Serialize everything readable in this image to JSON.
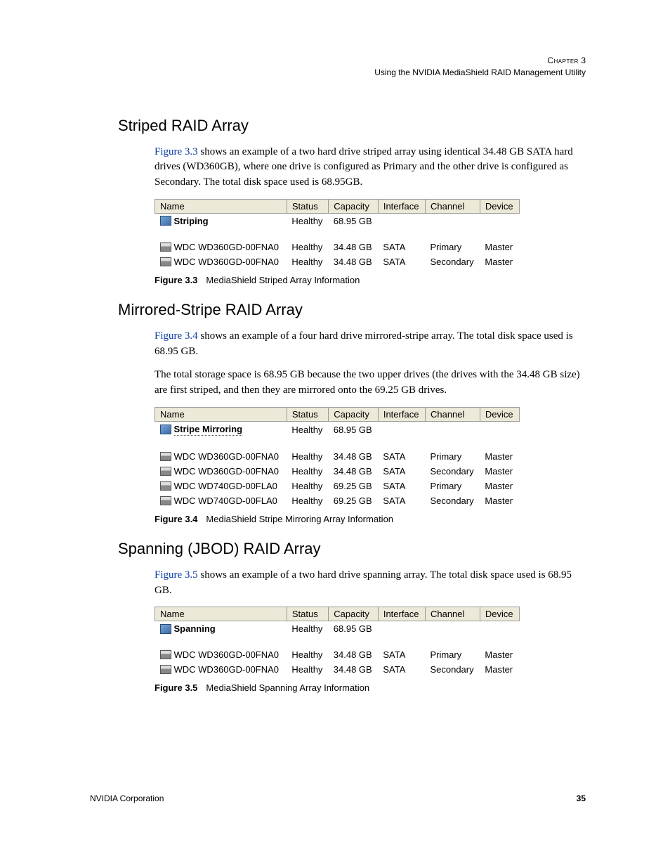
{
  "header": {
    "chapter_label": "Chapter",
    "chapter_number": "3",
    "subtitle": "Using the NVIDIA MediaShield RAID Management Utility"
  },
  "sections": {
    "striped": {
      "title": "Striped RAID Array",
      "ref": "Figure 3.3",
      "para1_rest": " shows an example of a two hard drive striped array using identical 34.48 GB SATA hard drives (WD360GB), where one drive is configured as Primary and the other drive is configured as Secondary. The total disk space used is 68.95GB.",
      "caption_num": "Figure 3.3",
      "caption_text": "MediaShield Striped Array Information",
      "table": {
        "headers": [
          "Name",
          "Status",
          "Capacity",
          "Interface",
          "Channel",
          "Device"
        ],
        "top_row": {
          "name": "Striping",
          "status": "Healthy",
          "capacity": "68.95 GB"
        },
        "rows": [
          {
            "name": "WDC WD360GD-00FNA0",
            "status": "Healthy",
            "capacity": "34.48 GB",
            "interface": "SATA",
            "channel": "Primary",
            "device": "Master"
          },
          {
            "name": "WDC WD360GD-00FNA0",
            "status": "Healthy",
            "capacity": "34.48 GB",
            "interface": "SATA",
            "channel": "Secondary",
            "device": "Master"
          }
        ]
      }
    },
    "mirrored": {
      "title": "Mirrored-Stripe RAID Array",
      "ref": "Figure 3.4",
      "para1_rest": " shows an example of a four hard drive mirrored-stripe array. The total disk space used is 68.95 GB.",
      "para2": "The total storage space is 68.95 GB because the two upper drives (the drives with the 34.48 GB size) are first striped, and then they are mirrored onto the 69.25 GB drives.",
      "caption_num": "Figure 3.4",
      "caption_text": "MediaShield Stripe Mirroring Array Information",
      "table": {
        "headers": [
          "Name",
          "Status",
          "Capacity",
          "Interface",
          "Channel",
          "Device"
        ],
        "top_row": {
          "name": "Stripe Mirroring",
          "status": "Healthy",
          "capacity": "68.95 GB"
        },
        "rows": [
          {
            "name": "WDC WD360GD-00FNA0",
            "status": "Healthy",
            "capacity": "34.48 GB",
            "interface": "SATA",
            "channel": "Primary",
            "device": "Master"
          },
          {
            "name": "WDC WD360GD-00FNA0",
            "status": "Healthy",
            "capacity": "34.48 GB",
            "interface": "SATA",
            "channel": "Secondary",
            "device": "Master"
          },
          {
            "name": "WDC WD740GD-00FLA0",
            "status": "Healthy",
            "capacity": "69.25 GB",
            "interface": "SATA",
            "channel": "Primary",
            "device": "Master"
          },
          {
            "name": "WDC WD740GD-00FLA0",
            "status": "Healthy",
            "capacity": "69.25 GB",
            "interface": "SATA",
            "channel": "Secondary",
            "device": "Master"
          }
        ]
      }
    },
    "spanning": {
      "title": "Spanning (JBOD) RAID Array",
      "ref": "Figure 3.5",
      "para1_rest": " shows an example of a two hard drive spanning array. The total disk space used is 68.95 GB.",
      "caption_num": "Figure 3.5",
      "caption_text": "MediaShield Spanning Array Information",
      "table": {
        "headers": [
          "Name",
          "Status",
          "Capacity",
          "Interface",
          "Channel",
          "Device"
        ],
        "top_row": {
          "name": "Spanning",
          "status": "Healthy",
          "capacity": "68.95 GB"
        },
        "rows": [
          {
            "name": "WDC WD360GD-00FNA0",
            "status": "Healthy",
            "capacity": "34.48 GB",
            "interface": "SATA",
            "channel": "Primary",
            "device": "Master"
          },
          {
            "name": "WDC WD360GD-00FNA0",
            "status": "Healthy",
            "capacity": "34.48 GB",
            "interface": "SATA",
            "channel": "Secondary",
            "device": "Master"
          }
        ]
      }
    }
  },
  "footer": {
    "company": "NVIDIA Corporation",
    "page": "35"
  }
}
